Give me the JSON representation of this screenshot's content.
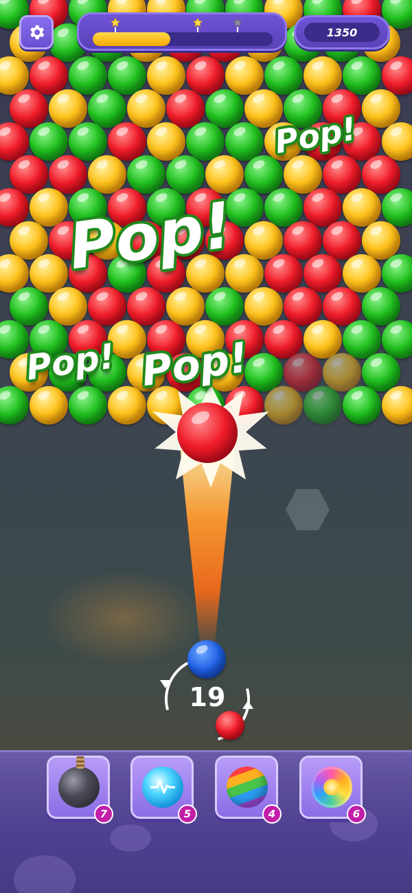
{
  "hud": {
    "level_progress": 0.43,
    "stars_earned": 2,
    "stars_total": 3,
    "score": "1350"
  },
  "effects": {
    "pop_labels": [
      "Pop!",
      "Pop!",
      "Pop!",
      "Pop!"
    ]
  },
  "launcher": {
    "shots_remaining": "19",
    "current_bubble_color": "blue",
    "next_bubble_color": "red"
  },
  "boosters": [
    {
      "name": "bomb",
      "count": "7"
    },
    {
      "name": "lightning",
      "count": "5"
    },
    {
      "name": "rainbow-ball",
      "count": "4"
    },
    {
      "name": "color-swirl",
      "count": "6"
    }
  ],
  "colors": {
    "red": "#e8202a",
    "green": "#1fb51f",
    "yellow": "#ffb300",
    "blue": "#1e5fe6",
    "hud_purple": "#6a4fd0",
    "star_gold": "#ffd84a",
    "pop_outline": "#1f8a1c",
    "badge": "#c21ea8"
  },
  "bubble_grid": [
    "GRGYYGGYGRG",
    "YGGYRRYGGYR",
    "YRGGYRYGYGR",
    "RYGYRGYGRYR",
    "RGGRYGGYRRY",
    "RRYGGYGYRRY",
    "RYGRGRGGRYG",
    "YRYRRRYRRYR",
    "YYRGRYYRRYG",
    "GYRRYGYRRGR",
    "GGRYRYRRYGG",
    "YGGYRYGRYGY",
    "GYGYYGRYGGY"
  ]
}
